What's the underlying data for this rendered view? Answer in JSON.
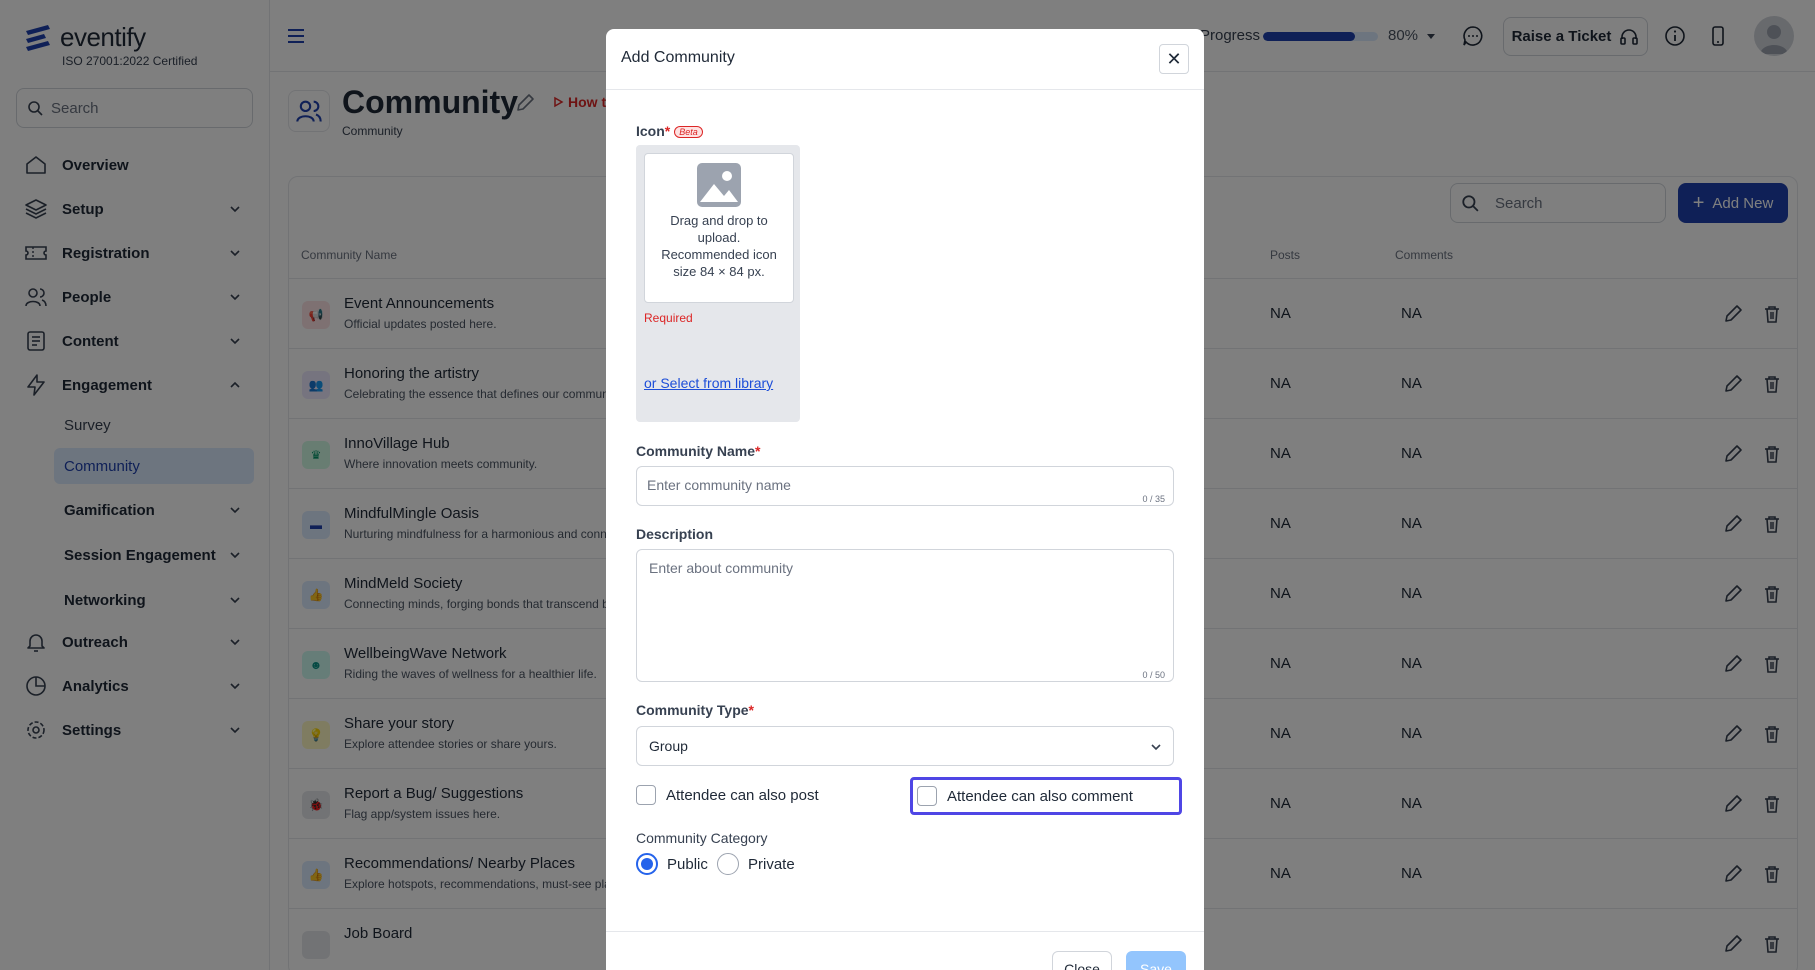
{
  "brand": {
    "name": "eventify",
    "certification": "ISO 27001:2022 Certified",
    "color": "#1e40af"
  },
  "sidebar": {
    "search_placeholder": "Search",
    "items": [
      {
        "label": "Overview",
        "icon": "home-icon"
      },
      {
        "label": "Setup",
        "icon": "layers-icon"
      },
      {
        "label": "Registration",
        "icon": "ticket-icon"
      },
      {
        "label": "People",
        "icon": "users-icon"
      },
      {
        "label": "Content",
        "icon": "file-list-icon"
      },
      {
        "label": "Engagement",
        "icon": "bolt-icon"
      },
      {
        "label": "Outreach",
        "icon": "bell-icon"
      },
      {
        "label": "Analytics",
        "icon": "pie-chart-icon"
      },
      {
        "label": "Settings",
        "icon": "gear-icon"
      }
    ],
    "engagement_sub": [
      "Survey",
      "Community",
      "Gamification",
      "Session Engagement",
      "Networking"
    ],
    "active_sub": "Community"
  },
  "topbar": {
    "progress_label": "Progress",
    "progress_value": "80%",
    "progress_fraction": 0.8,
    "raise_ticket": "Raise a Ticket"
  },
  "page": {
    "title": "Community",
    "breadcrumb": "Community",
    "how_to": "How to"
  },
  "table": {
    "search_placeholder": "Search",
    "add_new": "Add New",
    "columns": [
      "Community Name",
      "Posts",
      "Comments"
    ],
    "rows": [
      {
        "name": "Event Announcements",
        "desc": "Official updates posted here.",
        "posts": "NA",
        "comments": "NA",
        "icon": "megaphone-icon",
        "bg": "#fde2e4",
        "fg": "#e11d48",
        "glyph": "📢"
      },
      {
        "name": "Honoring the artistry",
        "desc": "Celebrating the essence that defines our community.",
        "posts": "NA",
        "comments": "NA",
        "icon": "people-icon",
        "bg": "#ede9fe",
        "fg": "#7c3aed",
        "glyph": "👥"
      },
      {
        "name": "InnoVillage Hub",
        "desc": "Where innovation meets community.",
        "posts": "NA",
        "comments": "NA",
        "icon": "crown-icon",
        "bg": "#d1fae5",
        "fg": "#059669",
        "glyph": "♛"
      },
      {
        "name": "MindfulMingle Oasis",
        "desc": "Nurturing mindfulness for a harmonious and connected community.",
        "posts": "NA",
        "comments": "NA",
        "icon": "chat-icon",
        "bg": "#dbeafe",
        "fg": "#1e40af",
        "glyph": "▬"
      },
      {
        "name": "MindMeld Society",
        "desc": "Connecting minds, forging bonds that transcend boundaries.",
        "posts": "NA",
        "comments": "NA",
        "icon": "thumbs-up-icon",
        "bg": "#dbeafe",
        "fg": "#2563eb",
        "glyph": "👍"
      },
      {
        "name": "WellbeingWave Network",
        "desc": "Riding the waves of wellness for a healthier life.",
        "posts": "NA",
        "comments": "NA",
        "icon": "smile-icon",
        "bg": "#ccfbf1",
        "fg": "#0d9488",
        "glyph": "☻"
      },
      {
        "name": "Share your story",
        "desc": "Explore attendee stories or share yours.",
        "posts": "NA",
        "comments": "NA",
        "icon": "bulb-icon",
        "bg": "#fef9c3",
        "fg": "#ca8a04",
        "glyph": "💡"
      },
      {
        "name": "Report a Bug/ Suggestions",
        "desc": "Flag app/system issues here.",
        "posts": "NA",
        "comments": "NA",
        "icon": "bug-icon",
        "bg": "#e5e7eb",
        "fg": "#b91c1c",
        "glyph": "🐞"
      },
      {
        "name": "Recommendations/ Nearby Places",
        "desc": "Explore hotspots, recommendations, must-see places.",
        "posts": "NA",
        "comments": "NA",
        "icon": "thumbs-up-icon",
        "bg": "#dbeafe",
        "fg": "#2563eb",
        "glyph": "👍"
      },
      {
        "name": "Job Board",
        "desc": "",
        "posts": "",
        "comments": "",
        "icon": "briefcase-icon",
        "bg": "#e5e7eb",
        "fg": "#374151",
        "glyph": ""
      }
    ]
  },
  "modal": {
    "title": "Add Community",
    "icon_label": "Icon",
    "beta": "Beta",
    "drop_text": "Drag and drop to upload. Recommended icon size 84 × 84 px.",
    "required": "Required",
    "library_link": "or Select from library",
    "name_label": "Community Name",
    "name_placeholder": "Enter community name",
    "name_counter": "0 / 35",
    "desc_label": "Description",
    "desc_placeholder": "Enter about community",
    "desc_counter": "0 / 50",
    "type_label": "Community Type",
    "type_value": "Group",
    "post_check": "Attendee can also post",
    "comment_check": "Attendee can also comment",
    "category_label": "Community Category",
    "public": "Public",
    "private": "Private",
    "close": "Close",
    "save": "Save"
  }
}
